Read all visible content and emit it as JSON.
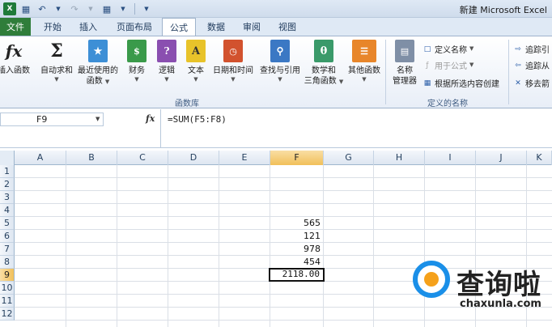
{
  "window": {
    "title": "新建 Microsoft Excel"
  },
  "qat": [
    "save-icon",
    "undo-icon",
    "redo-icon",
    "table-icon"
  ],
  "tabs": {
    "file": "文件",
    "items": [
      "开始",
      "插入",
      "页面布局",
      "公式",
      "数据",
      "审阅",
      "视图"
    ],
    "active": "公式"
  },
  "ribbon": {
    "function_library": {
      "group_label": "函数库",
      "buttons": [
        {
          "label": "插入函数",
          "icon": "fx-icon"
        },
        {
          "label": "自动求和",
          "icon": "sigma-icon",
          "dropdown": true
        },
        {
          "label": "最近使用的\n函数",
          "icon": "star-book-icon",
          "dropdown": true
        },
        {
          "label": "财务",
          "icon": "finance-book-icon",
          "dropdown": true
        },
        {
          "label": "逻辑",
          "icon": "logic-book-icon",
          "dropdown": true
        },
        {
          "label": "文本",
          "icon": "text-book-icon",
          "dropdown": true
        },
        {
          "label": "日期和时间",
          "icon": "datetime-book-icon",
          "dropdown": true
        },
        {
          "label": "查找与引用",
          "icon": "lookup-book-icon",
          "dropdown": true
        },
        {
          "label": "数学和\n三角函数",
          "icon": "math-book-icon",
          "dropdown": true
        },
        {
          "label": "其他函数",
          "icon": "other-book-icon",
          "dropdown": true
        }
      ]
    },
    "defined_names": {
      "group_label": "定义的名称",
      "manager_label": "名称\n管理器",
      "define_name": "定义名称",
      "use_in_formula": "用于公式",
      "create_from_selection": "根据所选内容创建"
    },
    "formula_auditing": {
      "trace_precedents": "追踪引",
      "trace_dependents": "追踪从",
      "remove_arrows": "移去箭"
    }
  },
  "formula_bar": {
    "name_box": "F9",
    "fx": "fx",
    "formula": "=SUM(F5:F8)"
  },
  "grid": {
    "columns": [
      "A",
      "B",
      "C",
      "D",
      "E",
      "F",
      "G",
      "H",
      "I",
      "J",
      "K"
    ],
    "rows": [
      "1",
      "2",
      "3",
      "4",
      "5",
      "6",
      "7",
      "8",
      "9",
      "10",
      "11",
      "12"
    ],
    "selected_column": "F",
    "selected_row": "9",
    "cells": [
      {
        "ref": "F5",
        "value": "565"
      },
      {
        "ref": "F6",
        "value": "121"
      },
      {
        "ref": "F7",
        "value": "978"
      },
      {
        "ref": "F8",
        "value": "454"
      },
      {
        "ref": "F9",
        "value": "2118.00",
        "active": true
      }
    ]
  },
  "watermark": {
    "title": "查询啦",
    "url": "chaxunla.com"
  }
}
